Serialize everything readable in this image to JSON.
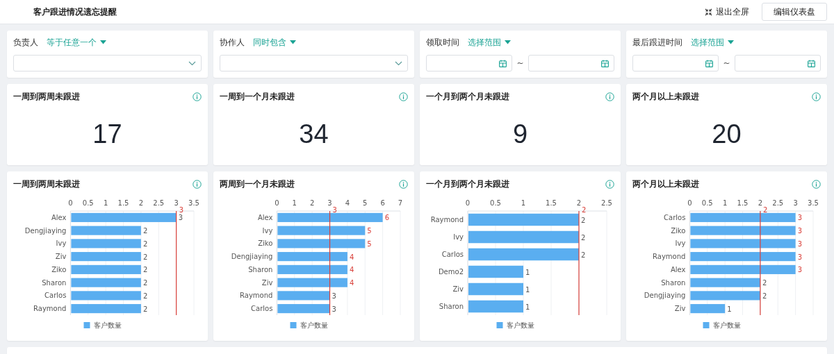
{
  "header": {
    "title": "客户跟进情况遗忘提醒",
    "exit_fullscreen": "退出全屏",
    "edit_button": "编辑仪表盘"
  },
  "filters": [
    {
      "label": "负责人",
      "operator": "等于任意一个",
      "kind": "select"
    },
    {
      "label": "协作人",
      "operator": "同时包含",
      "kind": "select"
    },
    {
      "label": "领取时间",
      "operator": "选择范围",
      "kind": "date_range",
      "separator": "~"
    },
    {
      "label": "最后跟进时间",
      "operator": "选择范围",
      "kind": "date_range",
      "separator": "~"
    }
  ],
  "kpis": [
    {
      "title": "一周到两周未跟进",
      "value": "17"
    },
    {
      "title": "一周到一个月未跟进",
      "value": "34"
    },
    {
      "title": "一个月到两个月未跟进",
      "value": "9"
    },
    {
      "title": "两个月以上未跟进",
      "value": "20"
    }
  ],
  "charts": [
    {
      "title": "一周到两周未跟进",
      "chart_data": {
        "type": "bar",
        "orientation": "horizontal",
        "categories": [
          "Alex",
          "Dengjiaying",
          "Ivy",
          "Ziv",
          "Ziko",
          "Sharon",
          "Carlos",
          "Raymond"
        ],
        "series": [
          {
            "name": "客户数量",
            "color": "#5aaef0",
            "values": [
              3,
              2,
              2,
              2,
              2,
              2,
              2,
              2
            ]
          }
        ],
        "xlim": [
          0,
          3.5
        ],
        "xticks": [
          0,
          0.5,
          1,
          1.5,
          2,
          2.5,
          3,
          3.5
        ],
        "data_labels": true,
        "grid": true,
        "ref_lines": [
          {
            "axis": "x",
            "value": 3,
            "label": "3",
            "color": "#d9403a"
          }
        ]
      }
    },
    {
      "title": "两周到一个月未跟进",
      "chart_data": {
        "type": "bar",
        "orientation": "horizontal",
        "categories": [
          "Alex",
          "Ivy",
          "Ziko",
          "Dengjiaying",
          "Sharon",
          "Ziv",
          "Raymond",
          "Carlos"
        ],
        "series": [
          {
            "name": "客户数量",
            "color": "#5aaef0",
            "values": [
              6,
              5,
              5,
              4,
              4,
              4,
              3,
              3
            ]
          }
        ],
        "xlim": [
          0,
          7
        ],
        "xticks": [
          0,
          1,
          2,
          3,
          4,
          5,
          6,
          7
        ],
        "data_labels": true,
        "grid": true,
        "ref_lines": [
          {
            "axis": "x",
            "value": 3,
            "label": "3",
            "color": "#d9403a"
          }
        ]
      }
    },
    {
      "title": "一个月到两个月未跟进",
      "chart_data": {
        "type": "bar",
        "orientation": "horizontal",
        "categories": [
          "Raymond",
          "Ivy",
          "Carlos",
          "Demo2",
          "Ziv",
          "Sharon"
        ],
        "series": [
          {
            "name": "客户数量",
            "color": "#5aaef0",
            "values": [
              2,
              2,
              2,
              1,
              1,
              1
            ]
          }
        ],
        "xlim": [
          0,
          2.5
        ],
        "xticks": [
          0,
          0.5,
          1,
          1.5,
          2,
          2.5
        ],
        "data_labels": true,
        "grid": true,
        "ref_lines": [
          {
            "axis": "x",
            "value": 2,
            "label": "2",
            "color": "#d9403a"
          }
        ]
      }
    },
    {
      "title": "两个月以上未跟进",
      "chart_data": {
        "type": "bar",
        "orientation": "horizontal",
        "categories": [
          "Carlos",
          "Ziko",
          "Ivy",
          "Raymond",
          "Alex",
          "Sharon",
          "Dengjiaying",
          "Ziv"
        ],
        "series": [
          {
            "name": "客户数量",
            "color": "#5aaef0",
            "values": [
              3,
              3,
              3,
              3,
              3,
              2,
              2,
              1
            ]
          }
        ],
        "xlim": [
          0,
          3.5
        ],
        "xticks": [
          0,
          0.5,
          1,
          1.5,
          2,
          2.5,
          3,
          3.5
        ],
        "data_labels": true,
        "grid": true,
        "ref_lines": [
          {
            "axis": "x",
            "value": 2,
            "label": "2",
            "color": "#d9403a"
          }
        ]
      }
    }
  ]
}
